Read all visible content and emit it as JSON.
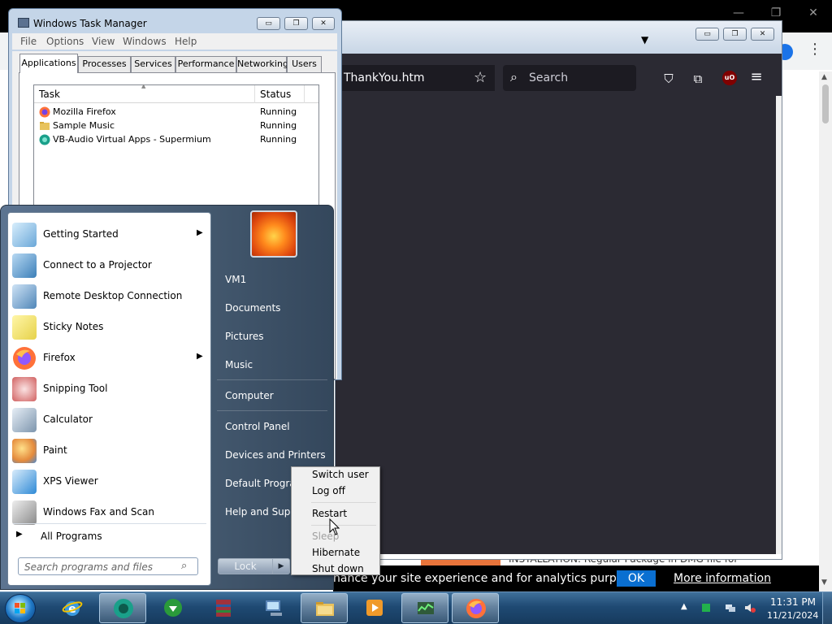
{
  "chrome": {
    "minimize_glyph": "—",
    "restore_glyph": "❐",
    "close_glyph": "✕",
    "menu_glyph": "⋮",
    "scroll_up": "▲",
    "scroll_down": "▼"
  },
  "cookie_bar": {
    "text": "hance your site experience and for analytics purposes.",
    "ok_label": "OK",
    "more_label": "More information"
  },
  "page_snippet": "INSTALLATION: Regular Package in DMG file for",
  "firefox": {
    "dropdown_glyph": "▼",
    "url_text": "ThankYou.htm",
    "bookmark_glyph": "☆",
    "search_glyph": "🔍",
    "search_placeholder": "Search",
    "pocket_glyph": "⛉",
    "extensions_glyph": "⧉",
    "ublock_label": "uO",
    "menu_glyph": "≡",
    "win_minimize": "▭",
    "win_restore": "❐",
    "win_close": "✕"
  },
  "task_manager": {
    "title": "Windows Task Manager",
    "win_minimize": "▭",
    "win_restore": "❐",
    "win_close": "✕",
    "menus": [
      "File",
      "Options",
      "View",
      "Windows",
      "Help"
    ],
    "tabs": [
      "Applications",
      "Processes",
      "Services",
      "Performance",
      "Networking",
      "Users"
    ],
    "active_tab": "Applications",
    "sort_glyph": "▲",
    "columns": [
      "Task",
      "Status"
    ],
    "rows": [
      {
        "task": "Mozilla Firefox",
        "status": "Running",
        "icon": "firefox-icon"
      },
      {
        "task": "Sample Music",
        "status": "Running",
        "icon": "folder-icon"
      },
      {
        "task": "VB-Audio Virtual Apps - Supermium",
        "status": "Running",
        "icon": "supermium-icon"
      }
    ]
  },
  "start_menu": {
    "programs": [
      {
        "label": "Getting Started",
        "icon": "getting-started-icon",
        "submenu": true
      },
      {
        "label": "Connect to a Projector",
        "icon": "projector-icon",
        "submenu": false
      },
      {
        "label": "Remote Desktop Connection",
        "icon": "remote-desktop-icon",
        "submenu": false
      },
      {
        "label": "Sticky Notes",
        "icon": "sticky-notes-icon",
        "submenu": false
      },
      {
        "label": "Firefox",
        "icon": "firefox-icon",
        "submenu": true
      },
      {
        "label": "Snipping Tool",
        "icon": "snipping-tool-icon",
        "submenu": false
      },
      {
        "label": "Calculator",
        "icon": "calculator-icon",
        "submenu": false
      },
      {
        "label": "Paint",
        "icon": "paint-icon",
        "submenu": false
      },
      {
        "label": "XPS Viewer",
        "icon": "xps-viewer-icon",
        "submenu": false
      },
      {
        "label": "Windows Fax and Scan",
        "icon": "fax-scan-icon",
        "submenu": false
      }
    ],
    "submenu_glyph": "▶",
    "all_programs": "All Programs",
    "search_placeholder": "Search programs and files",
    "search_glyph": "⌕",
    "links": [
      "VM1",
      "Documents",
      "Pictures",
      "Music",
      "Computer",
      "Control Panel",
      "Devices and Printers",
      "Default Programs",
      "Help and Support"
    ],
    "shutdown_label": "Lock",
    "shutdown_arrow": "▶"
  },
  "power_menu": {
    "items": [
      {
        "label": "Switch user",
        "enabled": true
      },
      {
        "label": "Log off",
        "enabled": true
      },
      {
        "label": "Restart",
        "enabled": true
      },
      {
        "label": "Sleep",
        "enabled": false
      },
      {
        "label": "Hibernate",
        "enabled": true
      },
      {
        "label": "Shut down",
        "enabled": true
      }
    ]
  },
  "taskbar": {
    "tray_arrow": "▲",
    "time": "11:31 PM",
    "date": "11/21/2024"
  },
  "colors": {
    "firefox_dark": "#2b2a33",
    "win7_taskbar": "#1f4a73",
    "cookie_ok": "#0a6fd1"
  }
}
